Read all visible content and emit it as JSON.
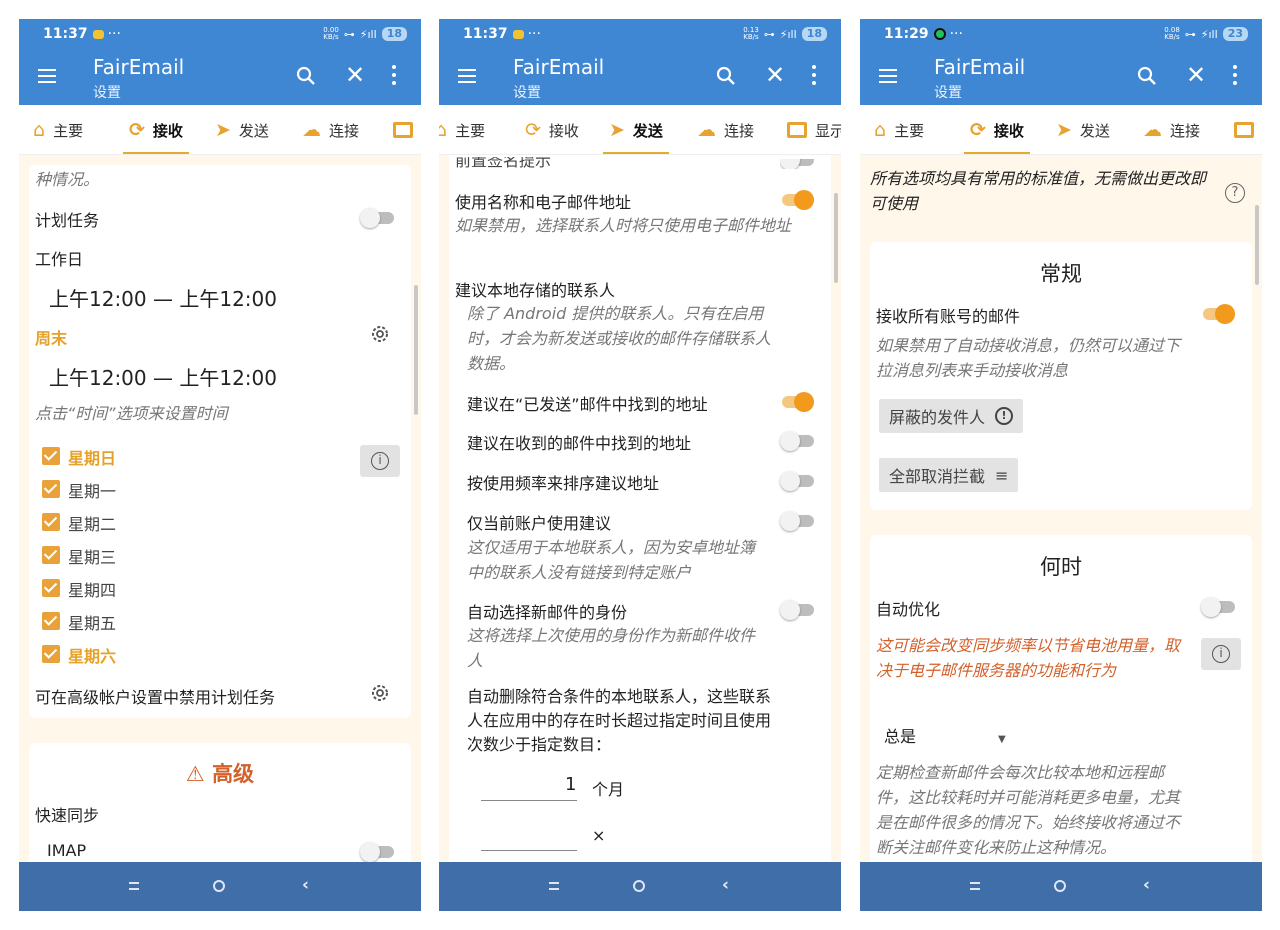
{
  "app": {
    "title": "FairEmail",
    "subtitle": "设置"
  },
  "phones": [
    {
      "status": {
        "time": "11:37",
        "more": "···",
        "speed_top": "0.00",
        "speed_bottom": "KB/s",
        "signal": "4G",
        "battery": "18"
      },
      "tabs": [
        "主要",
        "接收",
        "发送",
        "连接",
        "显示"
      ],
      "content": {
        "frag_top": "种情况。",
        "schedule_label": "计划任务",
        "workdays_label": "工作日",
        "workdays_time": "上午12:00  —  上午12:00",
        "weekend_label": "周末",
        "weekend_time": "上午12:00  —  上午12:00",
        "time_hint": "点击“时间”选项来设置时间",
        "days": [
          "星期日",
          "星期一",
          "星期二",
          "星期三",
          "星期四",
          "星期五",
          "星期六"
        ],
        "disable_hint": "可在高级帐户设置中禁用计划任务",
        "advanced_title": "高级",
        "fast_sync": "快速同步",
        "imap": "IMAP"
      }
    },
    {
      "status": {
        "time": "11:37",
        "more": "···",
        "speed_top": "0.13",
        "speed_bottom": "KB/s",
        "signal": "4G",
        "battery": "18"
      },
      "tabs": [
        "主要",
        "接收",
        "发送",
        "连接",
        "显示"
      ],
      "content": {
        "frag_top": "前置签名提示",
        "use_name": "使用名称和电子邮件地址",
        "use_name_hint": "如果禁用，选择联系人时将只使用电子邮件地址",
        "suggest_local": "建议本地存储的联系人",
        "suggest_local_hint": "除了 Android 提供的联系人。只有在启用时，才会为新发送或接收的邮件存储联系人数据。",
        "suggest_sent": "建议在“已发送”邮件中找到的地址",
        "suggest_received": "建议在收到的邮件中找到的地址",
        "sort_frequency": "按使用频率来排序建议地址",
        "current_account": "仅当前账户使用建议",
        "current_account_hint": "这仅适用于本地联系人，因为安卓地址簿中的联系人没有链接到特定账户",
        "auto_identity": "自动选择新邮件的身份",
        "auto_identity_hint": "这将选择上次使用的身份作为新邮件收件人",
        "auto_delete": "自动删除符合条件的本地联系人，这些联系人在应用中的存在时长超过指定时间且使用次数少于指定数目：",
        "months_value": "1",
        "months_unit": "个月",
        "times_unit": "×"
      }
    },
    {
      "status": {
        "time": "11:29",
        "more": "···",
        "speed_top": "0.08",
        "speed_bottom": "KB/s",
        "signal": "4G",
        "battery": "23"
      },
      "tabs": [
        "主要",
        "接收",
        "发送",
        "连接",
        "显示"
      ],
      "content": {
        "banner": "所有选项均具有常用的标准值，无需做出更改即可使用",
        "general_title": "常规",
        "poll_all": "接收所有账号的邮件",
        "poll_hint": "如果禁用了自动接收消息，仍然可以通过下拉消息列表来手动接收消息",
        "blocked_senders": "屏蔽的发件人",
        "unblock_all": "全部取消拦截",
        "when_title": "何时",
        "auto_optimize": "自动优化",
        "optimize_warning": "这可能会改变同步频率以节省电池用量，取决于电子邮件服务器的功能和行为",
        "frequency_value": "总是",
        "frequency_hint": "定期检查新邮件会每次比较本地和远程邮件，这比较耗时并可能消耗更多电量，尤其是在邮件很多的情况下。始终接收将通过不断关注邮件变化来防止这种情况。"
      }
    }
  ],
  "colors": {
    "appbar": "#3f86d3",
    "navbar": "#3f6ea9",
    "accent": "#f19a1c",
    "warning": "#d4602a"
  }
}
